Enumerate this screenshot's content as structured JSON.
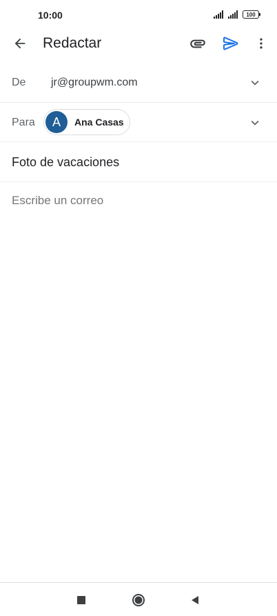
{
  "status_bar": {
    "time": "10:00",
    "battery": "100",
    "icons": [
      "signal-icon",
      "signal-icon",
      "battery-icon"
    ]
  },
  "toolbar": {
    "title": "Redactar",
    "icons": [
      "back-arrow-icon",
      "paperclip-icon",
      "send-icon",
      "more-vert-icon"
    ],
    "accent_color": "#1a73e8"
  },
  "compose": {
    "from_label": "De",
    "from_value": "jr@groupwm.com",
    "to_label": "Para",
    "recipient": {
      "initial": "A",
      "name": "Ana Casas",
      "avatar_color": "#1f5e96"
    },
    "subject": "Foto de vacaciones",
    "body_placeholder": "Escribe un correo"
  },
  "nav_bar": {
    "icons": [
      "square-icon",
      "circle-icon",
      "triangle-back-icon"
    ]
  }
}
